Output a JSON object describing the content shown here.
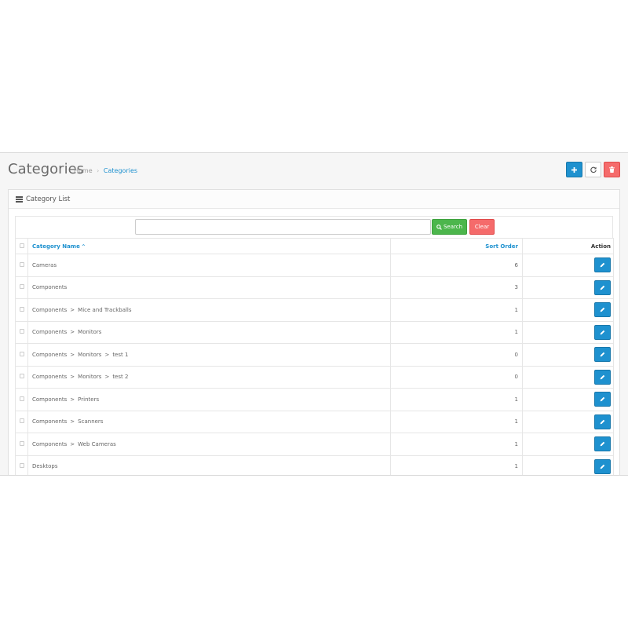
{
  "header": {
    "title": "Categories",
    "breadcrumb": {
      "home": "Home",
      "separator": "›",
      "current": "Categories"
    },
    "actions": {
      "add_icon": "plus-icon",
      "refresh_icon": "refresh-icon",
      "delete_icon": "trash-icon"
    }
  },
  "panel": {
    "title": "Category List",
    "icon": "list-icon"
  },
  "filter": {
    "search_value": "",
    "search_label": "Search",
    "clear_label": "Clear"
  },
  "table": {
    "columns": {
      "name": "Category Name",
      "sort_order": "Sort Order",
      "action": "Action"
    },
    "sort_indicator": "^",
    "rows": [
      {
        "path": [
          "Cameras"
        ],
        "sort_order": "6"
      },
      {
        "path": [
          "Components"
        ],
        "sort_order": "3"
      },
      {
        "path": [
          "Components",
          "Mice and Trackballs"
        ],
        "sort_order": "1"
      },
      {
        "path": [
          "Components",
          "Monitors"
        ],
        "sort_order": "1"
      },
      {
        "path": [
          "Components",
          "Monitors",
          "test 1"
        ],
        "sort_order": "0"
      },
      {
        "path": [
          "Components",
          "Monitors",
          "test 2"
        ],
        "sort_order": "0"
      },
      {
        "path": [
          "Components",
          "Printers"
        ],
        "sort_order": "1"
      },
      {
        "path": [
          "Components",
          "Scanners"
        ],
        "sort_order": "1"
      },
      {
        "path": [
          "Components",
          "Web Cameras"
        ],
        "sort_order": "1"
      },
      {
        "path": [
          "Desktops"
        ],
        "sort_order": "1"
      }
    ],
    "path_separator": ">"
  },
  "colors": {
    "primary": "#1e91cf",
    "success": "#4cb64c",
    "danger": "#f56b6b"
  }
}
